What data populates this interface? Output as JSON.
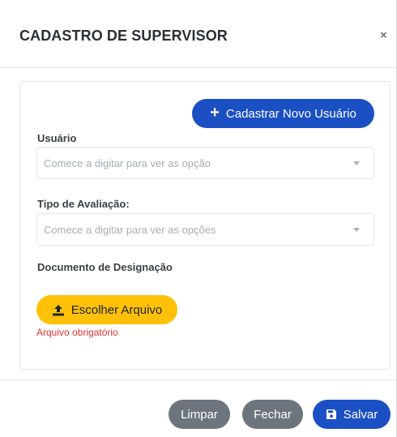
{
  "modal": {
    "title": "CADASTRO DE SUPERVISOR",
    "close_symbol": "×"
  },
  "form": {
    "new_user_button": {
      "label": "Cadastrar Novo Usuário",
      "icon": "plus-icon"
    },
    "usuario": {
      "label": "Usuário",
      "placeholder": "Comece a digitar para ver as opção"
    },
    "tipo_avaliacao": {
      "label": "Tipo de Avaliação:",
      "placeholder": "Comece a digitar para ver as opções"
    },
    "documento": {
      "label": "Documento de Designação",
      "button_label": "Escolher Arquivo",
      "button_icon": "upload-icon",
      "error": "Arquivo obrigatório"
    }
  },
  "footer": {
    "clear_label": "Limpar",
    "close_label": "Fechar",
    "save_label": "Salvar",
    "save_icon": "floppy-disk-icon"
  },
  "colors": {
    "primary": "#1b4fc4",
    "secondary": "#6c757d",
    "warning": "#ffc107",
    "danger": "#e03131"
  }
}
